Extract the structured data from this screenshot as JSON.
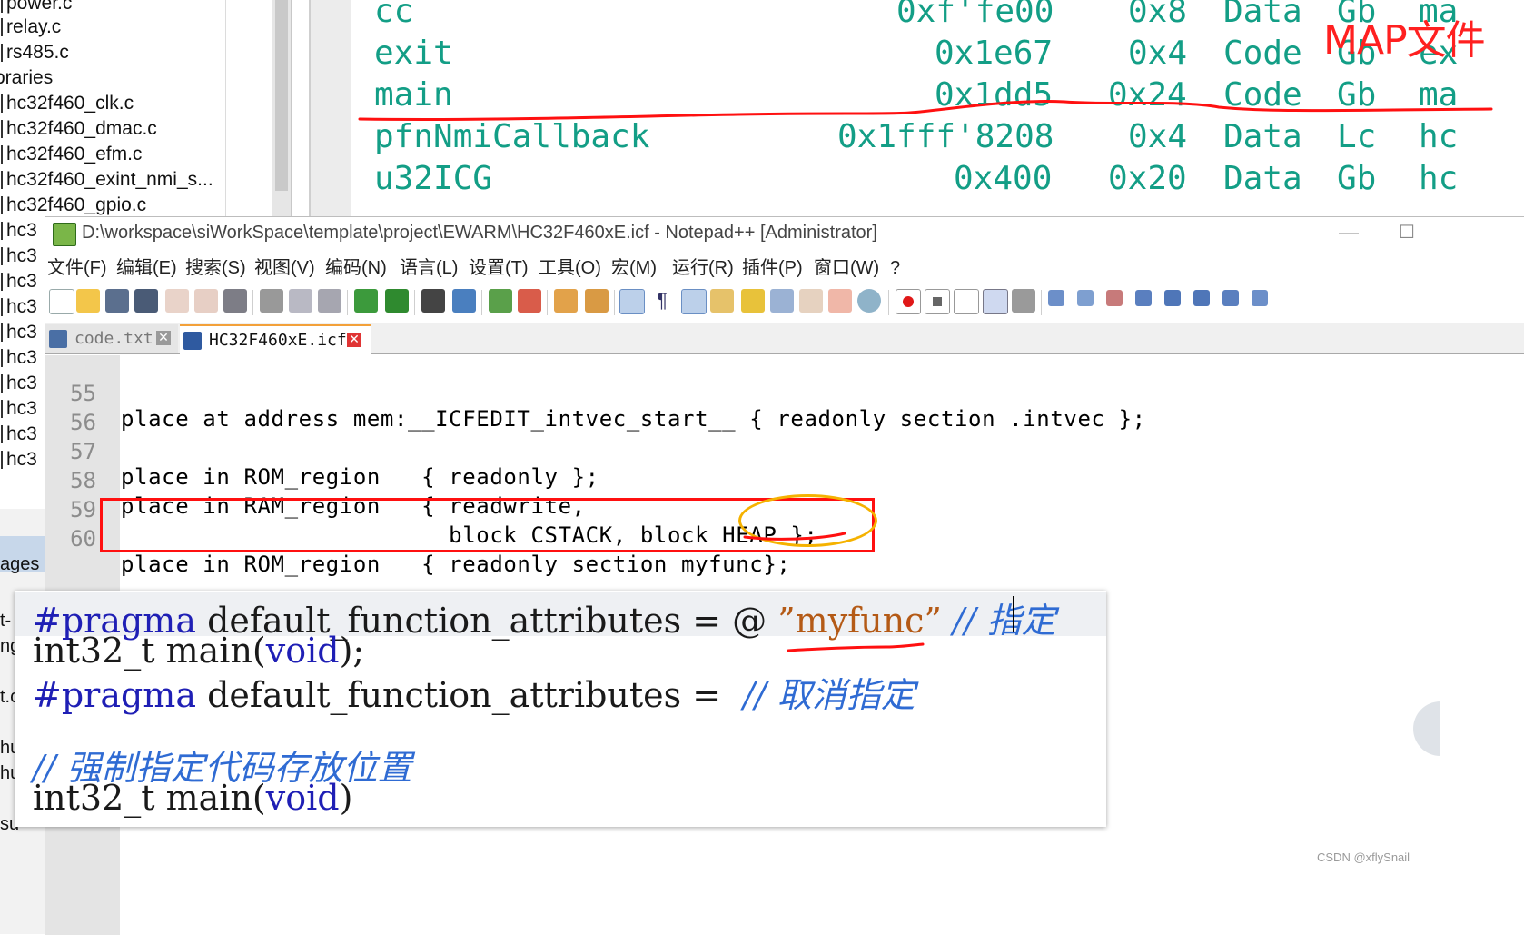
{
  "file_tree": {
    "items": [
      "power.c",
      "relay.c",
      "rs485.c",
      "oraries",
      "hc32f460_clk.c",
      "hc32f460_dmac.c",
      "hc32f460_efm.c",
      "hc32f460_exint_nmi_s...",
      "hc32f460_gpio.c",
      "hc3",
      "hc3",
      "hc3",
      "hc3",
      "hc3",
      "hc3",
      "hc3",
      "hc3",
      "hc3",
      "hc3"
    ],
    "fragments": [
      "ages",
      "t-",
      "ng",
      "t.c",
      "hu",
      "hu",
      "su"
    ]
  },
  "map_file": {
    "annotation": "MAP文件",
    "rows": [
      {
        "name": "cc",
        "address": "0xf'fe00",
        "size": "0x8",
        "type": "Data",
        "scope": "Gb",
        "module": "ma"
      },
      {
        "name": "exit",
        "address": "0x1e67",
        "size": "0x4",
        "type": "Code",
        "scope": "Gb",
        "module": "ex"
      },
      {
        "name": "main",
        "address": "0x1dd5",
        "size": "0x24",
        "type": "Code",
        "scope": "Gb",
        "module": "ma"
      },
      {
        "name": "pfnNmiCallback",
        "address": "0x1fff'8208",
        "size": "0x4",
        "type": "Data",
        "scope": "Lc",
        "module": "hc"
      },
      {
        "name": "u32ICG",
        "address": "0x400",
        "size": "0x20",
        "type": "Data",
        "scope": "Gb",
        "module": "hc"
      }
    ]
  },
  "notepad": {
    "title": "D:\\workspace\\siWorkSpace\\template\\project\\EWARM\\HC32F460xE.icf - Notepad++ [Administrator]",
    "window_controls": {
      "minimize": "—",
      "maximize": "☐"
    },
    "menu": [
      "文件(F)",
      "编辑(E)",
      "搜索(S)",
      "视图(V)",
      "编码(N)",
      "语言(L)",
      "设置(T)",
      "工具(O)",
      "宏(M)",
      "运行(R)",
      "插件(P)",
      "窗口(W)",
      "?"
    ],
    "tabs": [
      {
        "label": "code.txt",
        "active": false
      },
      {
        "label": "HC32F460xE.icf",
        "active": true
      }
    ],
    "close_glyph": "✕",
    "editor_lines": [
      {
        "num": "55",
        "text": "place at address mem:__ICFEDIT_intvec_start__ { readonly section .intvec };"
      },
      {
        "num": "56",
        "text": ""
      },
      {
        "num": "57",
        "text": "place in ROM_region   { readonly };"
      },
      {
        "num": "58",
        "text": "place in RAM_region   { readwrite,"
      },
      {
        "num": "59",
        "text": "                        block CSTACK, block HEAP };"
      },
      {
        "num": "60",
        "text": "place in ROM_region   { readonly section myfunc};"
      }
    ]
  },
  "snippet": {
    "line1": {
      "directive": "#pragma",
      "rest": " default_function_attributes = @ ",
      "string": "”myfunc”",
      "comment": " // 指定"
    },
    "line2": {
      "type": "int32_t main(",
      "kw": "void",
      "end": ");"
    },
    "line3": {
      "directive": "#pragma",
      "rest": " default_function_attributes =  ",
      "comment": "// 取消指定"
    },
    "line5": {
      "comment": "// 强制指定代码存放位置"
    },
    "line6": {
      "type": "int32_t main(",
      "kw": "void",
      "end": ")"
    }
  },
  "watermark": "CSDN @xflySnail",
  "colors": {
    "map_text": "#139e86",
    "annotation_red": "#ff2020",
    "highlight_yellow": "#f5b200",
    "keyword_blue": "#1f1fb5",
    "comment_blue": "#2f6bd3",
    "string_orange": "#b45a16"
  }
}
